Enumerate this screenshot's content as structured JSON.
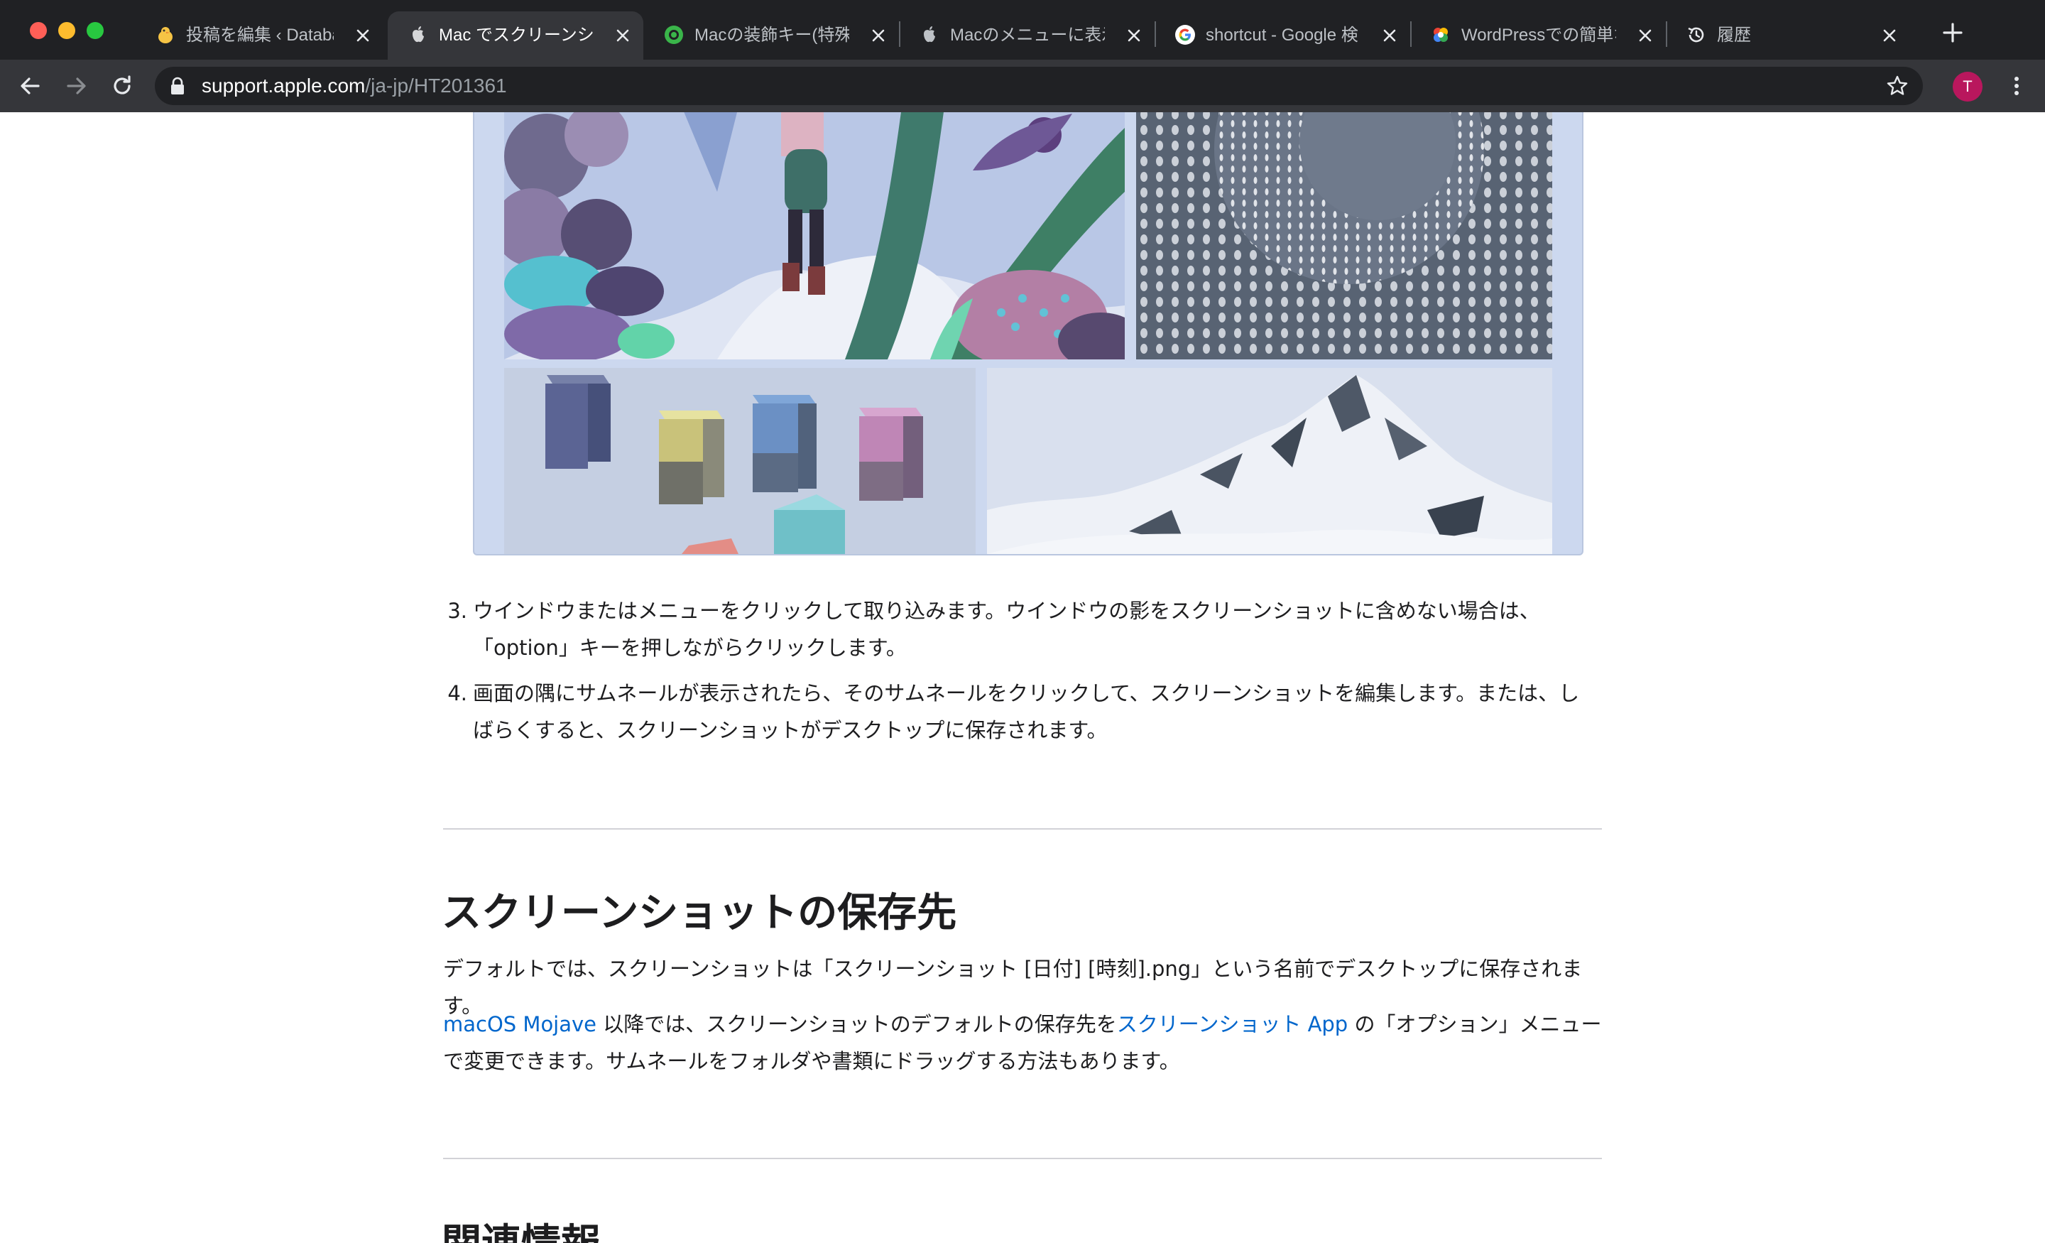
{
  "browser": {
    "tabs": [
      {
        "title": "投稿を編集 ‹ Databas",
        "icon": "chick-icon",
        "active": false
      },
      {
        "title": "Mac でスクリーンショ",
        "icon": "apple-icon",
        "active": true
      },
      {
        "title": "Macの装飾キー(特殊キ",
        "icon": "green-badge-icon",
        "active": false
      },
      {
        "title": "Macのメニューに表示",
        "icon": "apple-icon",
        "active": false
      },
      {
        "title": "shortcut - Google 検",
        "icon": "google-icon",
        "active": false
      },
      {
        "title": "WordPressでの簡単な",
        "icon": "colorful-logo-icon",
        "active": false
      },
      {
        "title": "履歴",
        "icon": "history-icon",
        "active": false
      }
    ],
    "url_host": "support.apple.com",
    "url_path": "/ja-jp/HT201361",
    "avatar_letter": "T"
  },
  "article": {
    "steps": [
      {
        "number": "3.",
        "text": "ウインドウまたはメニューをクリックして取り込みます。ウインドウの影をスクリーンショットに含めない場合は、「option」キーを押しながらクリックします。"
      },
      {
        "number": "4.",
        "text": "画面の隅にサムネールが表示されたら、そのサムネールをクリックして、スクリーンショットを編集します。または、しばらくすると、スクリーンショットがデスクトップに保存されます。"
      }
    ],
    "section1": {
      "heading": "スクリーンショットの保存先",
      "para1": "デフォルトでは、スクリーンショットは「スクリーンショット [日付] [時刻].png」という名前でデスクトップに保存されます。",
      "para2": {
        "link1": "macOS Mojave",
        "text1": " 以降では、スクリーンショットのデフォルトの保存先を",
        "link2": "スクリーンショット App",
        "text2": " の「オプション」メニューで変更できます。サムネールをフォルダや書類にドラッグする方法もあります。"
      }
    },
    "section2": {
      "heading": "関連情報"
    }
  },
  "colors": {
    "link": "#0066cc",
    "text": "#1d1d1f",
    "chrome_dark": "#202124",
    "chrome_toolbar": "#35363a"
  }
}
